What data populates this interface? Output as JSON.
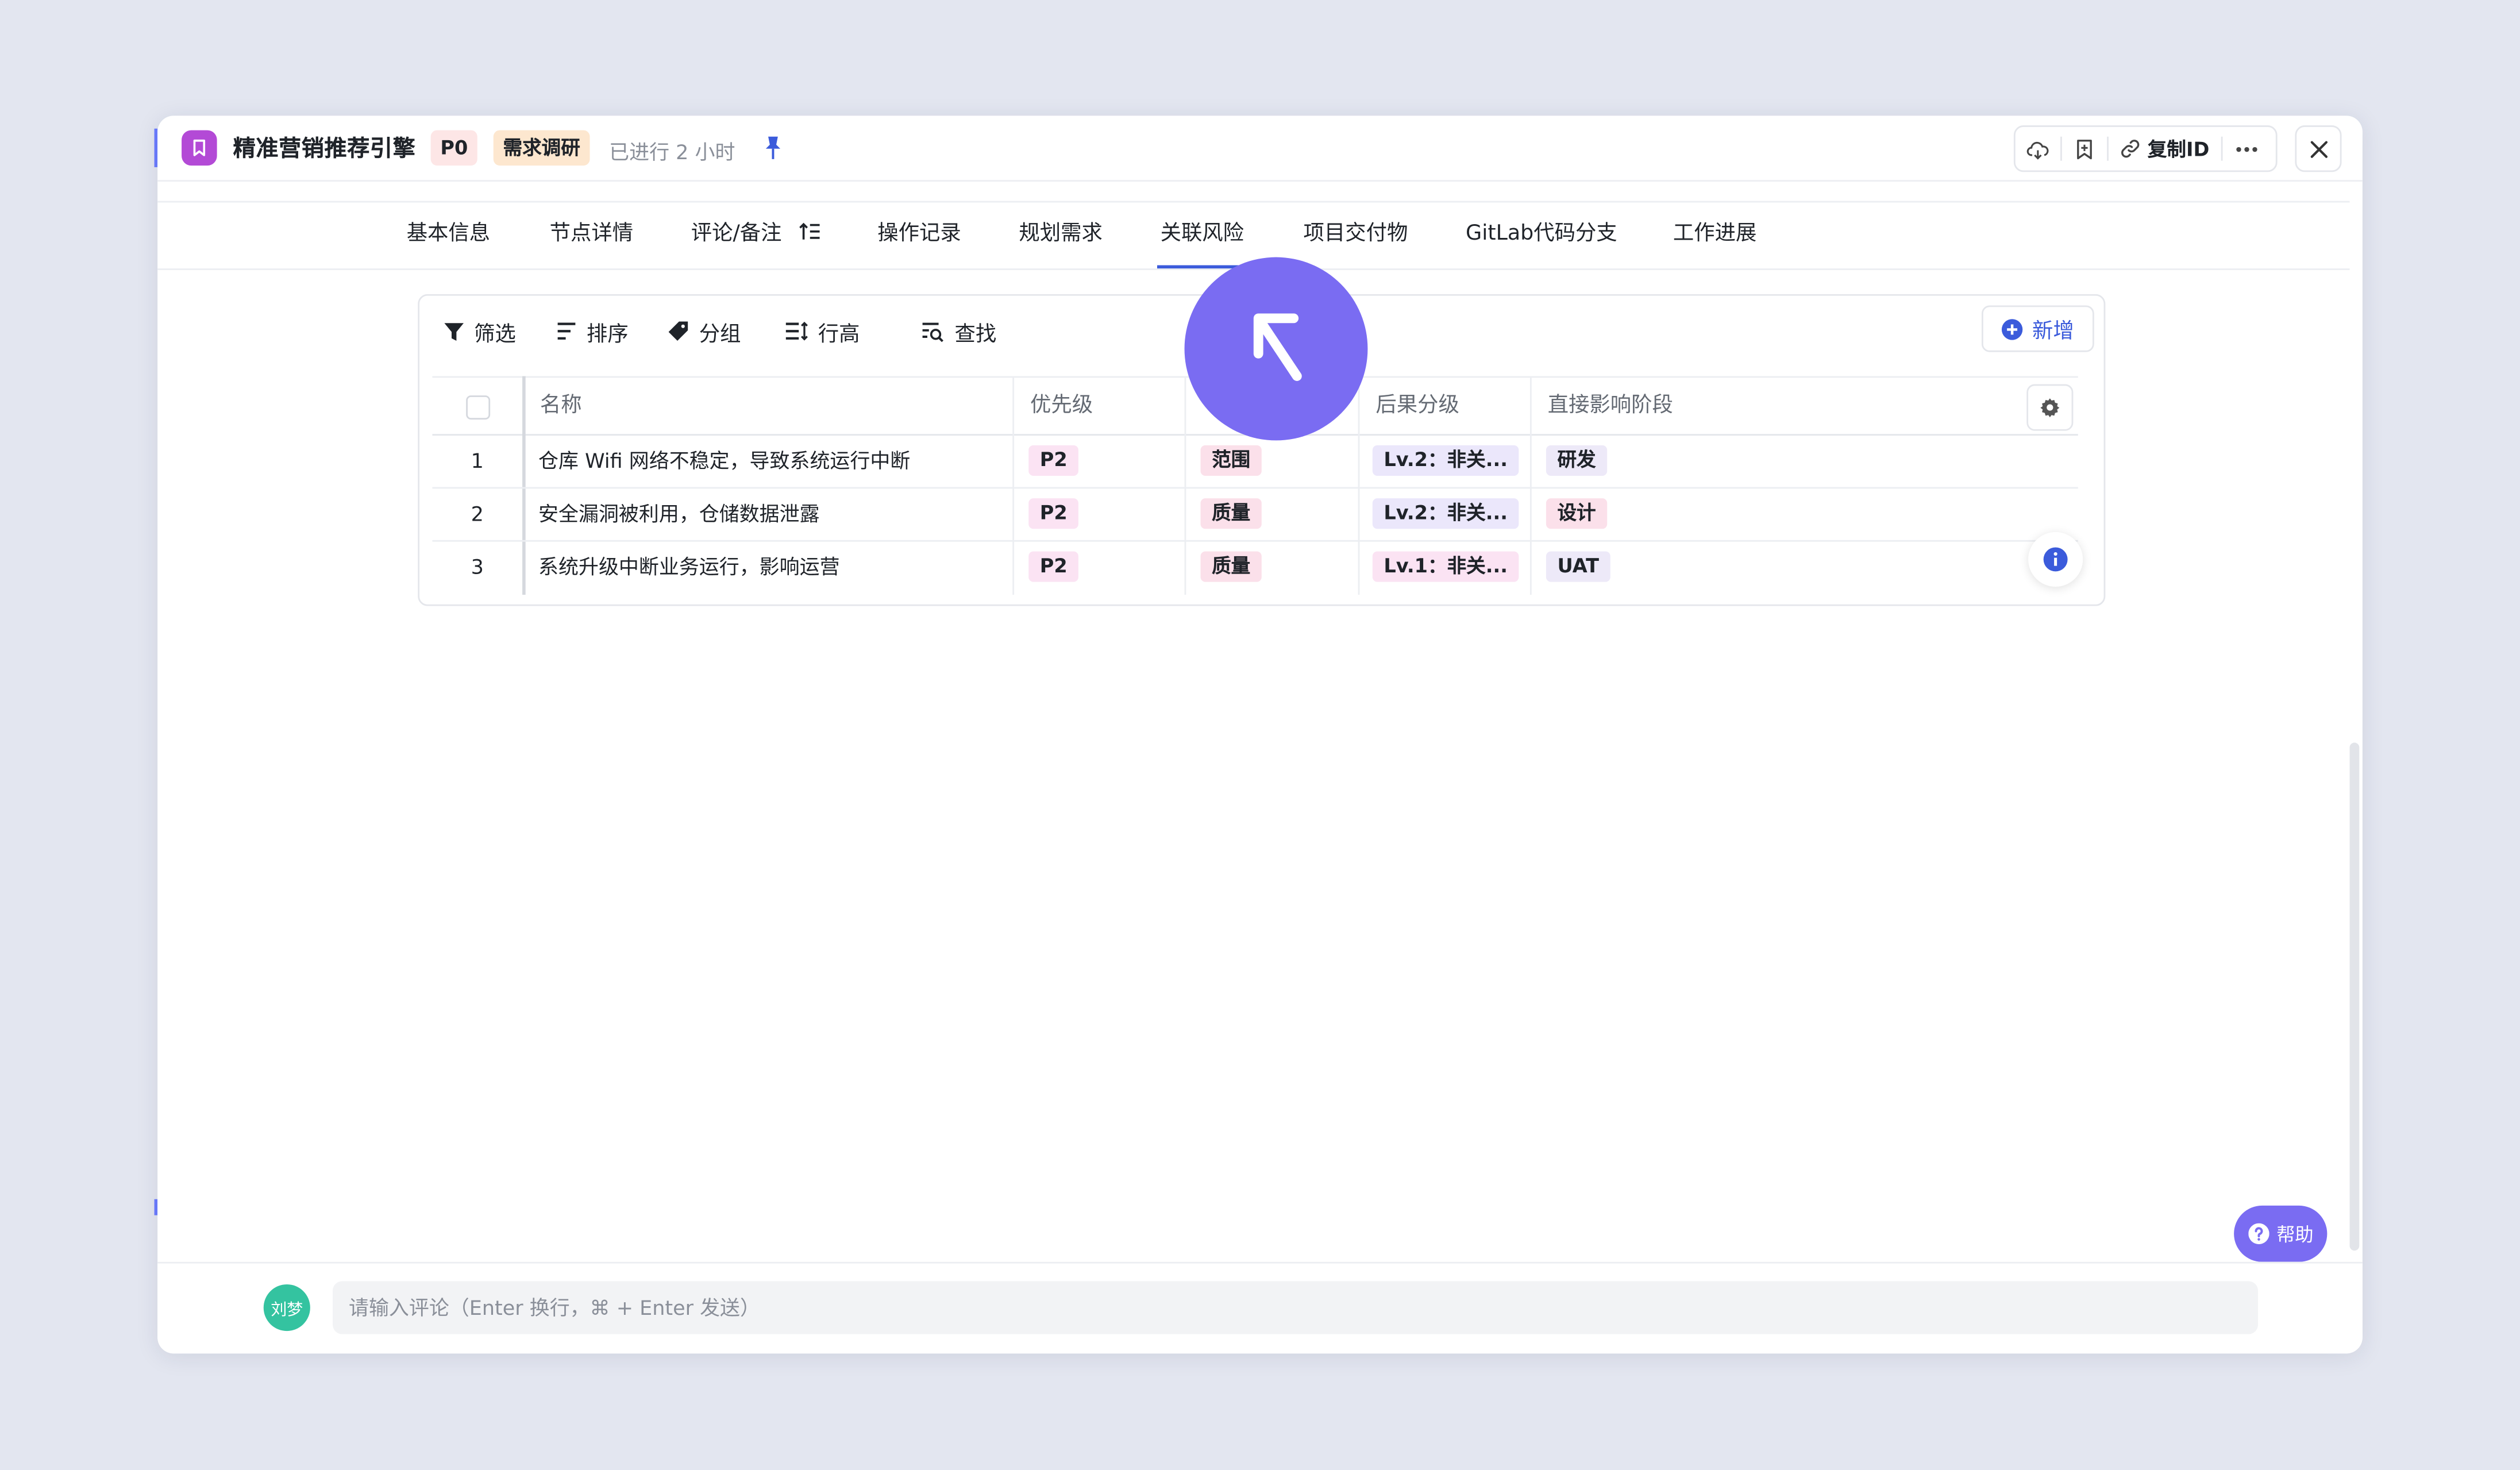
{
  "header": {
    "title": "精准营销推荐引擎",
    "priority_badge": "P0",
    "stage_badge": "需求调研",
    "elapsed": "已进行 2 小时",
    "copy_id_label": "复制ID"
  },
  "tabs": [
    {
      "label": "基本信息"
    },
    {
      "label": "节点详情"
    },
    {
      "label": "评论/备注"
    },
    {
      "label": "操作记录"
    },
    {
      "label": "规划需求"
    },
    {
      "label": "关联风险",
      "active": true
    },
    {
      "label": "项目交付物"
    },
    {
      "label": "GitLab代码分支"
    },
    {
      "label": "工作进展"
    }
  ],
  "toolbar": {
    "filter": "筛选",
    "sort": "排序",
    "group": "分组",
    "row_height": "行高",
    "find": "查找",
    "add": "新增"
  },
  "table": {
    "columns": [
      "名称",
      "优先级",
      "",
      "后果分级",
      "直接影响阶段"
    ],
    "rows": [
      {
        "index": "1",
        "name": "仓库 Wifi 网络不稳定，导致系统运行中断",
        "priority": "P2",
        "type": "范围",
        "level": "Lv.2：非关...",
        "stage": "研发"
      },
      {
        "index": "2",
        "name": "安全漏洞被利用，仓储数据泄露",
        "priority": "P2",
        "type": "质量",
        "level": "Lv.2：非关...",
        "stage": "设计"
      },
      {
        "index": "3",
        "name": "系统升级中断业务运行，影响运营",
        "priority": "P2",
        "type": "质量",
        "level": "Lv.1：非关...",
        "stage": "UAT"
      }
    ]
  },
  "help": {
    "label": "帮助"
  },
  "comment": {
    "avatar_name": "刘梦",
    "placeholder": "请输入评论（Enter 换行，⌘ + Enter 发送）"
  },
  "colors": {
    "accent": "#3b5bdb",
    "cursor_bubble": "#7a6cf2",
    "app_icon": "#b34ad6"
  }
}
